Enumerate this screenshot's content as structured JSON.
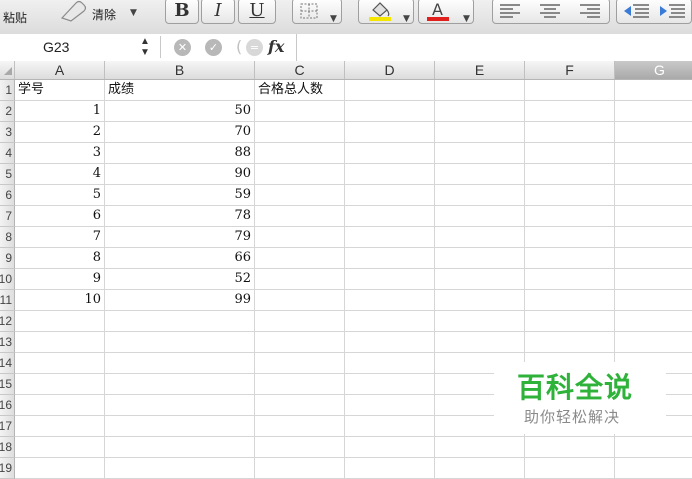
{
  "toolbar": {
    "paste_label": "粘贴",
    "clear_label": "清除",
    "bold_label": "B",
    "italic_label": "I",
    "underline_label": "U",
    "colors": {
      "fill_color": "#f5e600",
      "font_color": "#e0201c"
    },
    "icons": [
      "eraser-icon",
      "borders-icon",
      "fill-color-icon",
      "font-color-icon",
      "align-left-icon",
      "align-center-icon",
      "align-right-icon",
      "decrease-indent-icon",
      "increase-indent-icon"
    ]
  },
  "formula_bar": {
    "name_box": "G23",
    "fx_label": "fx",
    "formula": ""
  },
  "grid": {
    "columns": [
      "A",
      "B",
      "C",
      "D",
      "E",
      "F",
      "G"
    ],
    "selected_column": "G",
    "row_headers": [
      "1",
      "2",
      "3",
      "4",
      "5",
      "6",
      "7",
      "8",
      "9",
      "10",
      "11",
      "12",
      "13",
      "14",
      "15",
      "16",
      "17",
      "18",
      "19"
    ],
    "header_row": [
      "学号",
      "成绩",
      "合格总人数"
    ],
    "data_rows": [
      [
        "1",
        "50"
      ],
      [
        "2",
        "70"
      ],
      [
        "3",
        "88"
      ],
      [
        "4",
        "90"
      ],
      [
        "5",
        "59"
      ],
      [
        "6",
        "78"
      ],
      [
        "7",
        "79"
      ],
      [
        "8",
        "66"
      ],
      [
        "9",
        "52"
      ],
      [
        "10",
        "99"
      ]
    ]
  },
  "watermark": {
    "title": "百科全说",
    "subtitle": "助你轻松解决"
  }
}
